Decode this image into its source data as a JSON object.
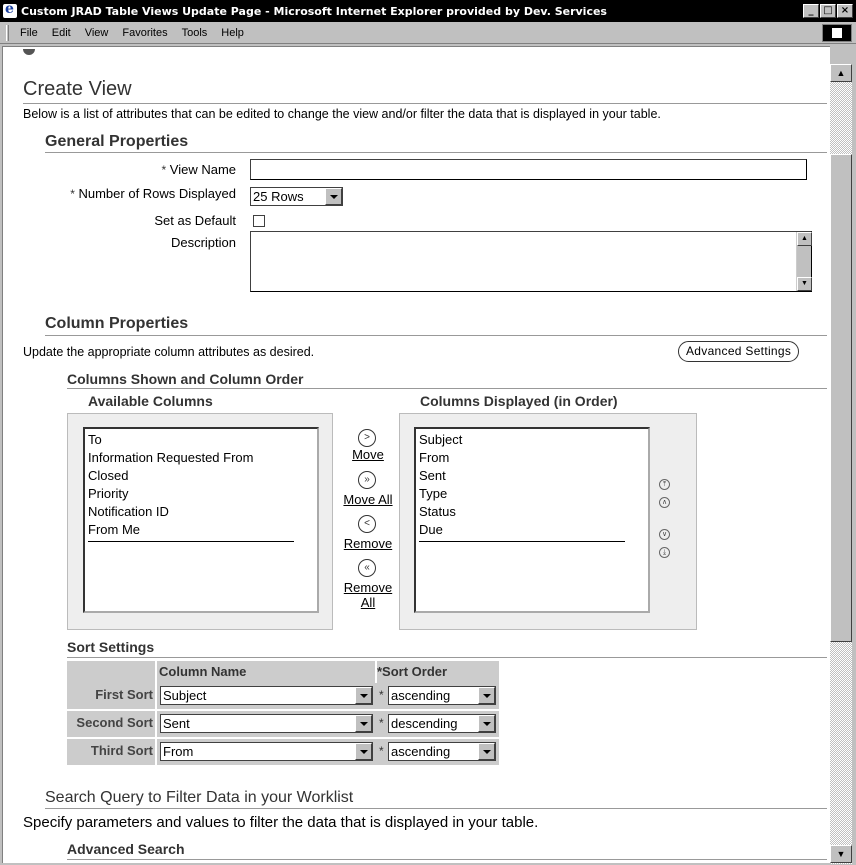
{
  "window": {
    "title": "Custom JRAD Table Views Update Page - Microsoft Internet Explorer provided by Dev. Services",
    "minimize": "_",
    "maximize": "□",
    "close": "×"
  },
  "menu": {
    "items": [
      "File",
      "Edit",
      "View",
      "Favorites",
      "Tools",
      "Help"
    ]
  },
  "page": {
    "title": "Create View",
    "intro": "Below is a list of attributes that can be edited to change the view and/or filter the data that is displayed in your table."
  },
  "general": {
    "heading": "General Properties",
    "view_name_label": "View Name",
    "view_name_value": "",
    "rows_label": "Number of Rows Displayed",
    "rows_value": "25 Rows",
    "default_label": "Set as Default",
    "default_checked": false,
    "description_label": "Description",
    "description_value": "",
    "required_marker": "*"
  },
  "columns": {
    "heading": "Column Properties",
    "instructions": "Update the appropriate column attributes as desired.",
    "advanced_button": "Advanced Settings",
    "shown_heading": "Columns Shown and Column Order",
    "available_heading": "Available Columns",
    "displayed_heading": "Columns Displayed (in Order)",
    "available": [
      "To",
      "Information Requested From",
      "Closed",
      "Priority",
      "Notification ID",
      "From Me"
    ],
    "displayed": [
      "Subject",
      "From",
      "Sent",
      "Type",
      "Status",
      "Due"
    ],
    "move": "Move",
    "move_all": "Move All",
    "remove": "Remove",
    "remove_all_1": "Remove",
    "remove_all_2": "All"
  },
  "sort": {
    "heading": "Sort Settings",
    "col_name_header": "Column Name",
    "sort_order_header": "*Sort Order",
    "rows": [
      {
        "label": "First Sort",
        "column": "Subject",
        "order": "ascending"
      },
      {
        "label": "Second Sort",
        "column": "Sent",
        "order": "descending"
      },
      {
        "label": "Third Sort",
        "column": "From",
        "order": "ascending"
      }
    ]
  },
  "search": {
    "heading": "Search Query to Filter Data in your Worklist",
    "instructions": "Specify parameters and values to filter the data that is displayed in your table.",
    "advanced_heading": "Advanced Search"
  }
}
